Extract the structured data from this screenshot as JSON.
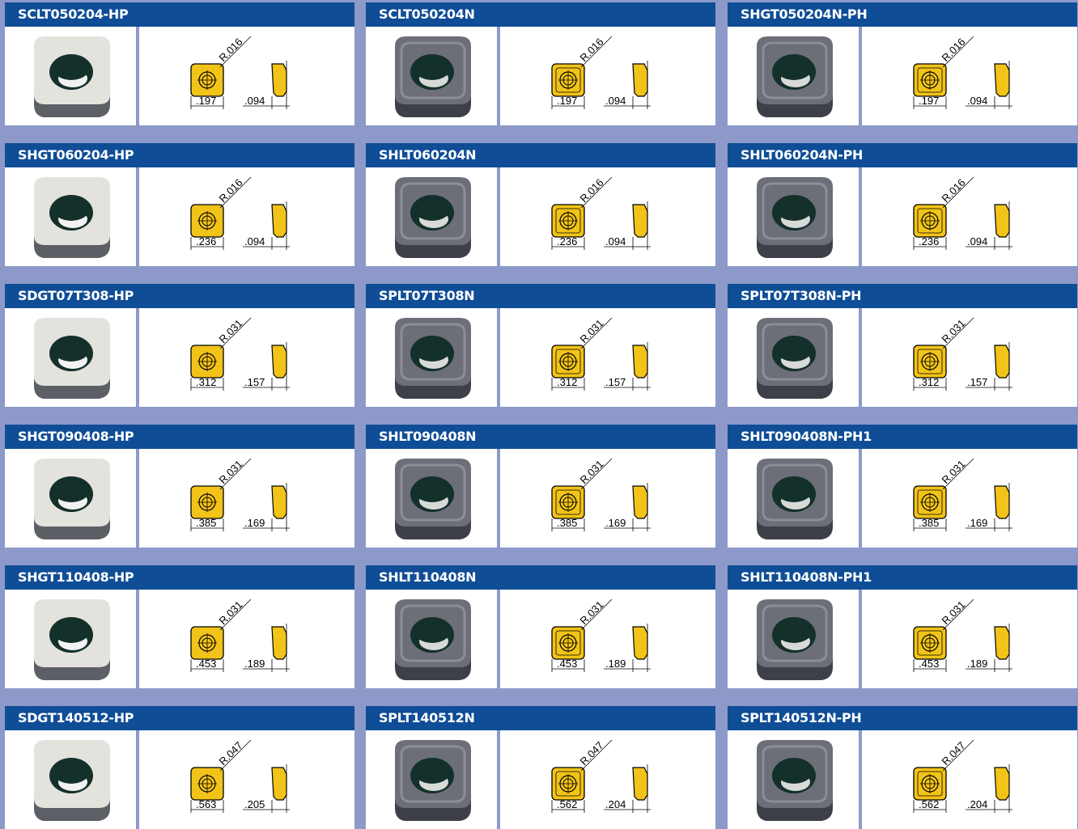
{
  "colors": {
    "background": "#8d9ac9",
    "header": "#0f4d96",
    "insert_yellow": "#f2c318",
    "coated_insert": "#6c6e78",
    "uncoated_insert": "#e4e2dd"
  },
  "inserts": [
    {
      "code": "SCLT050204-HP",
      "radius": "R.016",
      "size": ".197",
      "thickness": ".094",
      "variant": "light"
    },
    {
      "code": "SCLT050204N",
      "radius": "R.016",
      "size": ".197",
      "thickness": ".094",
      "variant": "dark"
    },
    {
      "code": "SHGT050204N-PH",
      "radius": "R.016",
      "size": ".197",
      "thickness": ".094",
      "variant": "dark"
    },
    {
      "code": "SHGT060204-HP",
      "radius": "R.016",
      "size": ".236",
      "thickness": ".094",
      "variant": "light"
    },
    {
      "code": "SHLT060204N",
      "radius": "R.016",
      "size": ".236",
      "thickness": ".094",
      "variant": "dark"
    },
    {
      "code": "SHLT060204N-PH",
      "radius": "R.016",
      "size": ".236",
      "thickness": ".094",
      "variant": "dark"
    },
    {
      "code": "SDGT07T308-HP",
      "radius": "R.031",
      "size": ".312",
      "thickness": ".157",
      "variant": "light"
    },
    {
      "code": "SPLT07T308N",
      "radius": "R.031",
      "size": ".312",
      "thickness": ".157",
      "variant": "dark"
    },
    {
      "code": "SPLT07T308N-PH",
      "radius": "R.031",
      "size": ".312",
      "thickness": ".157",
      "variant": "dark"
    },
    {
      "code": "SHGT090408-HP",
      "radius": "R.031",
      "size": ".385",
      "thickness": ".169",
      "variant": "light"
    },
    {
      "code": "SHLT090408N",
      "radius": "R.031",
      "size": ".385",
      "thickness": ".169",
      "variant": "dark"
    },
    {
      "code": "SHLT090408N-PH1",
      "radius": "R.031",
      "size": ".385",
      "thickness": ".169",
      "variant": "dark"
    },
    {
      "code": "SHGT110408-HP",
      "radius": "R.031",
      "size": ".453",
      "thickness": ".189",
      "variant": "light"
    },
    {
      "code": "SHLT110408N",
      "radius": "R.031",
      "size": ".453",
      "thickness": ".189",
      "variant": "dark"
    },
    {
      "code": "SHLT110408N-PH1",
      "radius": "R.031",
      "size": ".453",
      "thickness": ".189",
      "variant": "dark"
    },
    {
      "code": "SDGT140512-HP",
      "radius": "R.047",
      "size": ".563",
      "thickness": ".205",
      "variant": "light"
    },
    {
      "code": "SPLT140512N",
      "radius": "R.047",
      "size": ".562",
      "thickness": ".204",
      "variant": "dark"
    },
    {
      "code": "SPLT140512N-PH",
      "radius": "R.047",
      "size": ".562",
      "thickness": ".204",
      "variant": "dark"
    }
  ]
}
